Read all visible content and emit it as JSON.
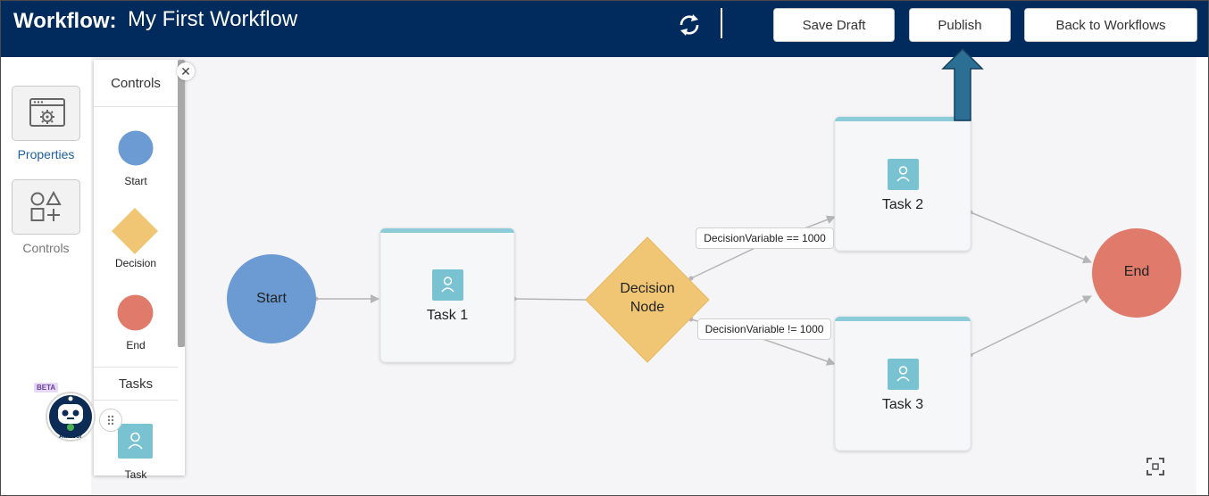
{
  "header": {
    "label": "Workflow:",
    "name": "My First Workflow",
    "save_draft": "Save Draft",
    "publish": "Publish",
    "back": "Back to Workflows"
  },
  "rail": {
    "properties": "Properties",
    "controls": "Controls"
  },
  "palette": {
    "controls_title": "Controls",
    "start": "Start",
    "decision": "Decision",
    "end": "End",
    "tasks_title": "Tasks",
    "task": "Task"
  },
  "nodes": {
    "start": "Start",
    "task1": "Task 1",
    "decision_line1": "Decision",
    "decision_line2": "Node",
    "task2": "Task 2",
    "task3": "Task 3",
    "end": "End"
  },
  "edges": {
    "eq": "DecisionVariable == 1000",
    "neq": "DecisionVariable != 1000"
  },
  "advisor": {
    "badge": "BETA",
    "label": "Advisor"
  },
  "colors": {
    "header": "#002b5c",
    "start": "#6b9bd2",
    "decision": "#f0c674",
    "end": "#e07a6b",
    "task_icon": "#78c2d2",
    "task_bar": "#8ccbd8",
    "arrow": "#2b6f95"
  }
}
